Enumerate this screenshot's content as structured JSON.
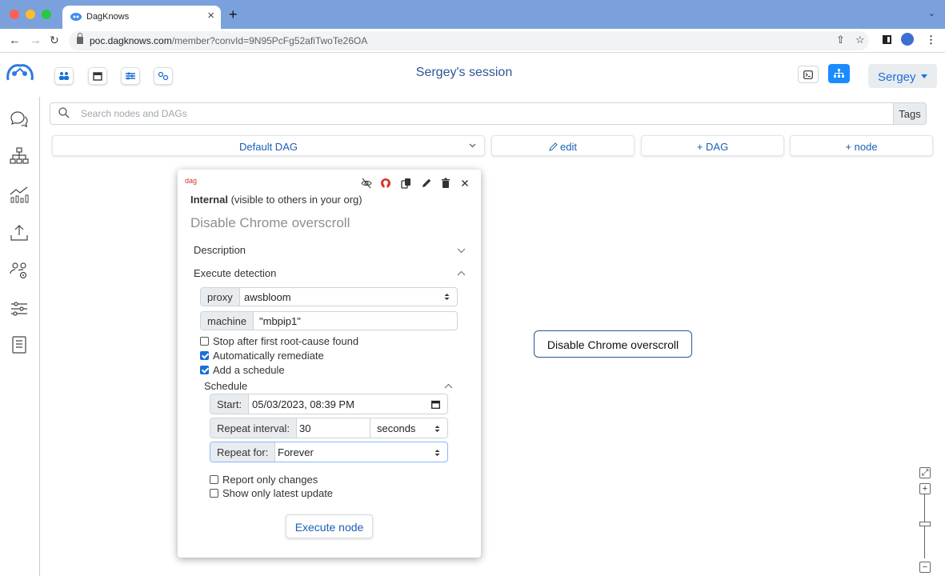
{
  "browser": {
    "tab_title": "DagKnows",
    "url_host": "poc.dagknows.com",
    "url_path": "/member?convId=9N95PcFg52afiTwoTe26OA"
  },
  "header": {
    "session_title": "Sergey's session",
    "user_name": "Sergey"
  },
  "search": {
    "placeholder": "Search nodes and DAGs",
    "tags_label": "Tags"
  },
  "dag_toolbar": {
    "selected_dag": "Default DAG",
    "edit_label": "edit",
    "add_dag_label": "+ DAG",
    "add_node_label": "+ node"
  },
  "node_card": {
    "tag": "dag",
    "visibility_bold": "Internal",
    "visibility_rest": "(visible to others in your org)",
    "title": "Disable Chrome overscroll",
    "description_label": "Description",
    "execute_detection_label": "Execute detection",
    "proxy_label": "proxy",
    "proxy_value": "awsbloom",
    "machine_label": "machine",
    "machine_value": "\"mbpip1\"",
    "checkboxes": [
      {
        "label": "Stop after first root-cause found",
        "checked": false
      },
      {
        "label": "Automatically remediate",
        "checked": true
      },
      {
        "label": "Add a schedule",
        "checked": true
      }
    ],
    "schedule_label": "Schedule",
    "start_label": "Start:",
    "start_value": "05/03/2023, 08:39 PM",
    "repeat_interval_label": "Repeat interval:",
    "repeat_interval_value": "30",
    "repeat_unit": "seconds",
    "repeat_for_label": "Repeat for:",
    "repeat_for_value": "Forever",
    "report_checkboxes": [
      {
        "label": "Report only changes",
        "checked": false
      },
      {
        "label": "Show only latest update",
        "checked": false
      }
    ],
    "execute_button_label": "Execute node"
  },
  "graph": {
    "node_label": "Disable Chrome overscroll"
  },
  "zoom": {
    "plus": "+",
    "minus": "−",
    "level": 0.5
  },
  "colors": {
    "accent": "#1a6fd8",
    "tab_bar": "#7aa1dc",
    "title_blue": "#2b5797",
    "error_red": "#d9342b"
  },
  "icons": [
    "team-icon",
    "calendar-icon",
    "sliders-icon",
    "gears-icon",
    "terminal-icon",
    "sitemap-icon",
    "chat-icon",
    "hierarchy-icon",
    "analytics-icon",
    "upload-icon",
    "users-settings-icon",
    "settings-icon",
    "book-icon",
    "eye-slash-icon",
    "github-icon",
    "copy-icon",
    "pencil-icon",
    "trash-icon",
    "close-icon"
  ]
}
